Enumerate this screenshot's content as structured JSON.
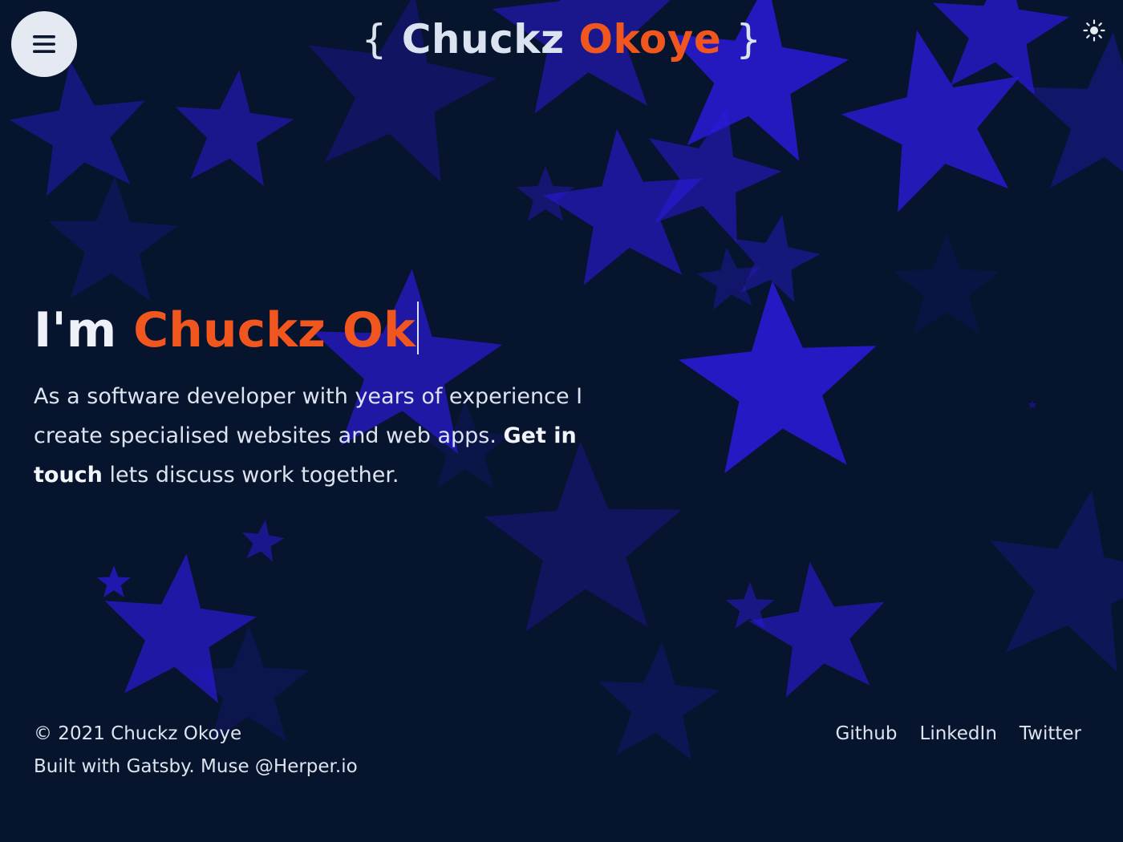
{
  "header": {
    "logo_open_brace": "{",
    "logo_first_name": "Chuckz",
    "logo_last_name": "Okoye",
    "logo_close_brace": "}",
    "menu_icon": "hamburger-menu-icon",
    "theme_icon": "sun-icon"
  },
  "hero": {
    "greeting": "I'm",
    "typed_name": "Chuckz Ok",
    "description_start": "As a software developer with years of experience I create specialised websites and web apps.",
    "cta_label": "Get in touch",
    "description_end": "lets discuss work together."
  },
  "footer": {
    "copyright": "© 2021 Chuckz Okoye",
    "credit": "Built with Gatsby. Muse @Herper.io",
    "links": [
      "Github",
      "LinkedIn",
      "Twitter"
    ]
  },
  "colors": {
    "background": "#06142e",
    "accent": "#f0561d",
    "text": "#dde4ef",
    "star": "#2a1ad8"
  }
}
